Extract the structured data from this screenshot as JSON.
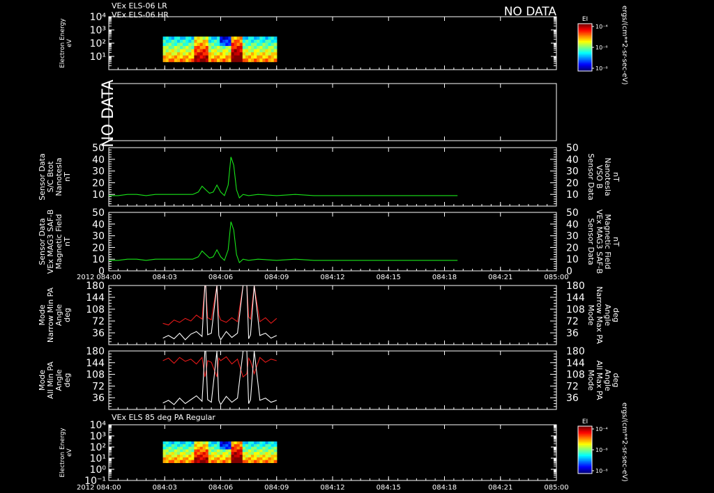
{
  "header": {
    "line1": "VEx ELS-06 LR",
    "line2": "VEx ELS-06 HR",
    "no_data": "NO DATA"
  },
  "colors": {
    "white": "#ffffff",
    "green": "#19e619",
    "red": "#e61919",
    "background": "#000000"
  },
  "time_axis": {
    "year": "2012",
    "ticks": [
      "084:00",
      "084:03",
      "084:06",
      "084:09",
      "084:12",
      "084:15",
      "084:18",
      "084:21",
      "085:00"
    ],
    "range_minutes": [
      0,
      24
    ]
  },
  "colorbar": {
    "title": "EI",
    "ticks": [
      "10⁻⁴",
      "10⁻⁶",
      "10⁻⁸"
    ],
    "unit": "ergs/(cm**2-sr-sec-eV)"
  },
  "chart_data": [
    {
      "id": "spectrogram-lr-hr",
      "type": "heatmap",
      "ylabel": [
        "Electron Energy",
        "eV"
      ],
      "yticks": [
        "10⁴",
        "10³",
        "10²",
        "10¹"
      ],
      "data_time_range_minutes": [
        2.9,
        9.0
      ],
      "energy_range_log10_eV": [
        0.6,
        2.5
      ]
    },
    {
      "id": "no-data-panel",
      "type": "table",
      "label": "NO DATA"
    },
    {
      "id": "sc-btot",
      "type": "line",
      "ylabel_left": [
        "Sensor Data",
        "S/C Btot",
        "Nanotesla",
        "nT"
      ],
      "ylabel_right": [
        "Sensor Data",
        "VSO B",
        "Nanotesla",
        "nT"
      ],
      "yticks": [
        "50",
        "40",
        "30",
        "20",
        "10"
      ],
      "ylim": [
        0,
        50
      ],
      "series": [
        {
          "color": "#19e619",
          "x": [
            0.0,
            0.5,
            1.0,
            1.5,
            2.0,
            2.5,
            3.0,
            3.5,
            4.0,
            4.5,
            4.8,
            5.0,
            5.2,
            5.4,
            5.6,
            5.8,
            6.0,
            6.2,
            6.4,
            6.55,
            6.7,
            6.85,
            7.0,
            7.2,
            7.5,
            8.0,
            9.0,
            10.0,
            11.0,
            12.0,
            13.0,
            14.0,
            15.0,
            16.0,
            17.0,
            18.0,
            18.7
          ],
          "y": [
            9,
            9,
            10,
            10,
            9,
            10,
            10,
            10,
            10,
            10,
            12,
            17,
            14,
            11,
            12,
            18,
            12,
            9,
            18,
            42,
            35,
            14,
            7,
            10,
            9,
            10,
            9,
            10,
            9,
            9,
            9,
            9,
            9,
            9,
            9,
            9,
            9
          ]
        }
      ]
    },
    {
      "id": "mag-field",
      "type": "line",
      "ylabel_left": [
        "Sensor Data",
        "VEx MAG3 SAF-B",
        "Magnetic Field",
        "nT"
      ],
      "ylabel_right": [
        "Sensor Data",
        "VEx MAG3 SAF-B",
        "Magnetic Field",
        "nT"
      ],
      "yticks": [
        "50",
        "40",
        "30",
        "20",
        "10",
        "0"
      ],
      "ylim": [
        0,
        50
      ],
      "series": [
        {
          "color": "#19e619",
          "x": [
            0.0,
            0.5,
            1.0,
            1.5,
            2.0,
            2.5,
            3.0,
            3.5,
            4.0,
            4.5,
            4.8,
            5.0,
            5.2,
            5.4,
            5.6,
            5.8,
            6.0,
            6.2,
            6.4,
            6.55,
            6.7,
            6.85,
            7.0,
            7.2,
            7.5,
            8.0,
            9.0,
            10.0,
            11.0,
            12.0,
            13.0,
            14.0,
            15.0,
            16.0,
            17.0,
            18.0,
            18.7
          ],
          "y": [
            9,
            9,
            10,
            10,
            9,
            10,
            10,
            10,
            10,
            10,
            12,
            17,
            14,
            11,
            12,
            18,
            12,
            9,
            18,
            42,
            35,
            14,
            7,
            10,
            9,
            10,
            9,
            10,
            9,
            9,
            9,
            9,
            9,
            9,
            9,
            9,
            9
          ]
        }
      ]
    },
    {
      "id": "narrow-pa",
      "type": "line",
      "ylabel_left": [
        "Mode",
        "Narrow Min PA",
        "Angle",
        "deg"
      ],
      "ylabel_right": [
        "Mode",
        "Narrow Max PA",
        "Angle",
        "deg"
      ],
      "yticks": [
        "180",
        "144",
        "108",
        "72",
        "36"
      ],
      "ylim": [
        0,
        180
      ],
      "series": [
        {
          "color": "#e61919",
          "x": [
            2.9,
            3.2,
            3.5,
            3.8,
            4.1,
            4.4,
            4.7,
            5.0,
            5.15,
            5.2,
            5.3,
            5.5,
            5.8,
            5.9,
            6.0,
            6.3,
            6.6,
            6.9,
            7.2,
            7.4,
            7.5,
            7.6,
            7.8,
            8.1,
            8.4,
            8.7,
            9.0
          ],
          "y": [
            65,
            60,
            75,
            68,
            80,
            72,
            90,
            78,
            180,
            180,
            82,
            76,
            180,
            90,
            75,
            68,
            82,
            70,
            180,
            180,
            85,
            78,
            180,
            70,
            82,
            65,
            80
          ]
        },
        {
          "color": "#ffffff",
          "x": [
            2.9,
            3.2,
            3.5,
            3.8,
            4.1,
            4.4,
            4.7,
            5.0,
            5.15,
            5.2,
            5.3,
            5.5,
            5.8,
            5.9,
            6.0,
            6.3,
            6.6,
            6.9,
            7.2,
            7.4,
            7.5,
            7.6,
            7.8,
            8.1,
            8.4,
            8.7,
            9.0
          ],
          "y": [
            20,
            28,
            18,
            35,
            15,
            32,
            40,
            25,
            180,
            180,
            30,
            35,
            180,
            28,
            15,
            40,
            22,
            35,
            180,
            180,
            18,
            30,
            180,
            28,
            35,
            20,
            28
          ]
        }
      ]
    },
    {
      "id": "all-pa",
      "type": "line",
      "ylabel_left": [
        "Mode",
        "All Min PA",
        "Angle",
        "deg"
      ],
      "ylabel_right": [
        "Mode",
        "All Max PA",
        "Angle",
        "deg"
      ],
      "yticks": [
        "180",
        "144",
        "108",
        "72",
        "36"
      ],
      "ylim": [
        0,
        180
      ],
      "series": [
        {
          "color": "#e61919",
          "x": [
            2.9,
            3.2,
            3.5,
            3.8,
            4.1,
            4.4,
            4.7,
            5.0,
            5.15,
            5.2,
            5.3,
            5.5,
            5.8,
            5.9,
            6.0,
            6.3,
            6.6,
            6.9,
            7.2,
            7.4,
            7.5,
            7.6,
            7.8,
            8.1,
            8.4,
            8.7,
            9.0
          ],
          "y": [
            150,
            158,
            142,
            160,
            148,
            155,
            140,
            160,
            100,
            110,
            150,
            145,
            100,
            158,
            150,
            162,
            140,
            155,
            100,
            110,
            158,
            148,
            110,
            160,
            145,
            155,
            150
          ]
        },
        {
          "color": "#ffffff",
          "x": [
            2.9,
            3.2,
            3.5,
            3.8,
            4.1,
            4.4,
            4.7,
            5.0,
            5.15,
            5.2,
            5.3,
            5.5,
            5.8,
            5.9,
            6.0,
            6.3,
            6.6,
            6.9,
            7.2,
            7.4,
            7.5,
            7.6,
            7.8,
            8.1,
            8.4,
            8.7,
            9.0
          ],
          "y": [
            20,
            28,
            15,
            35,
            18,
            30,
            42,
            25,
            180,
            180,
            30,
            22,
            180,
            28,
            15,
            40,
            22,
            35,
            180,
            180,
            18,
            30,
            180,
            28,
            35,
            22,
            28
          ]
        }
      ]
    },
    {
      "id": "spectrogram-85deg",
      "type": "heatmap",
      "title": "VEx ELS 85 deg PA Regular",
      "ylabel": [
        "Electron Energy",
        "eV"
      ],
      "yticks": [
        "10⁴",
        "10³",
        "10²",
        "10¹",
        "10⁰",
        "10⁻¹"
      ],
      "data_time_range_minutes": [
        2.9,
        9.0
      ],
      "energy_range_log10_eV": [
        0.6,
        2.5
      ]
    }
  ]
}
